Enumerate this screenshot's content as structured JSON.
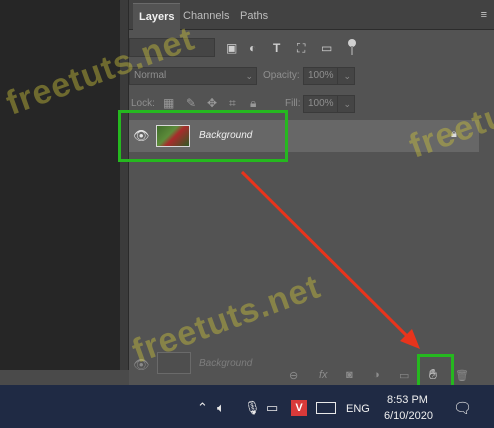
{
  "panel": {
    "tabs": [
      {
        "label": "Layers",
        "active": true
      },
      {
        "label": "Channels",
        "active": false
      },
      {
        "label": "Paths",
        "active": false
      }
    ],
    "menu_glyph": "≡",
    "collapse_glyph": "»",
    "blend_mode": "Normal",
    "opacity_label": "Opacity:",
    "opacity_value": "100%",
    "lock_label": "Lock:",
    "fill_label": "Fill:",
    "fill_value": "100%"
  },
  "layers": [
    {
      "name": "Background",
      "visible": true,
      "locked": true
    }
  ],
  "drag_preview": {
    "name": "Background"
  },
  "watermark": "freetuts.net",
  "taskbar": {
    "language": "ENG",
    "time": "8:53 PM",
    "date": "6/10/2020"
  },
  "colors": {
    "highlight": "#25b81f",
    "arrow": "#e8341c",
    "taskbar": "#1f2a44",
    "panel": "#535353"
  }
}
